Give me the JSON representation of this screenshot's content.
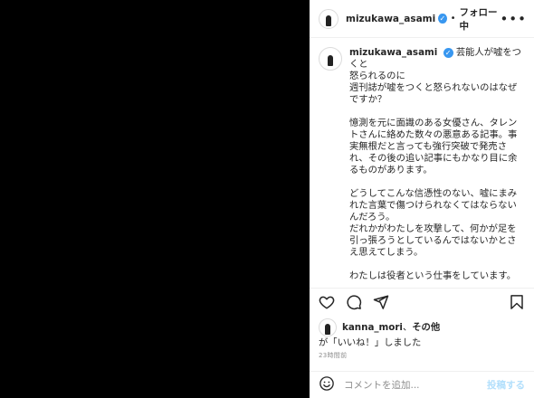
{
  "post": {
    "username": "mizukawa_asami",
    "follow_status": "フォロー中",
    "header_dot": "•",
    "more_icon": "more-horizontal-icon",
    "verified_icon": "verified-badge-icon"
  },
  "caption": {
    "username": "mizukawa_asami",
    "title_lines": [
      "芸能人が嘘をつくと",
      "怒られるのに",
      "週刊誌が嘘をつくと怒られないのはなぜ",
      "ですか？"
    ],
    "paragraphs": [
      [
        "憶測を元に面識のある女優さん、タレン",
        "トさんに絡めた数々の悪意ある記事。事",
        "実無根だと言っても強行突破で発売さ",
        "れ、その後の追い記事にもかなり目に余",
        "るものがあります。"
      ],
      [
        "どうしてこんな信憑性のない、嘘にまみ",
        "れた言葉で傷つけられなくてはならない",
        "んだろう。",
        "だれかがわたしを攻撃して、何かが足を",
        "引っ張ろうとしているんではないかとさ",
        "え思えてしまう。"
      ],
      [
        "わたしは役者という仕事をしています。"
      ]
    ]
  },
  "actions": {
    "like_icon": "heart-icon",
    "comment_icon": "comment-icon",
    "share_icon": "share-icon",
    "save_icon": "bookmark-icon"
  },
  "likes": {
    "user": "kanna_mori",
    "joiner": "、",
    "others": "その他",
    "suffix": "が「いいね！」しました"
  },
  "timestamp": "23時間前",
  "comment": {
    "placeholder": "コメントを追加...",
    "emoji_icon": "emoji-icon",
    "post_label": "投稿する"
  },
  "colors": {
    "accent": "#3897f0",
    "post_button_disabled": "#b2dffc",
    "media_background": "#000000"
  }
}
